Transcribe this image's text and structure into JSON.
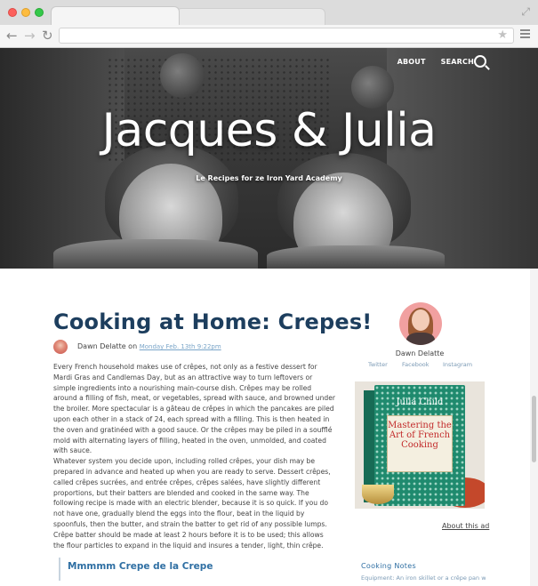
{
  "browser": {
    "icons": {
      "close": "red-dot",
      "minimize": "yellow-dot",
      "maximize": "green-dot",
      "back": "back-arrow-icon",
      "forward": "forward-arrow-icon",
      "reload": "reload-icon",
      "bookmark": "star-icon",
      "menu": "hamburger-menu-icon",
      "fullscreen": "expand-icon"
    }
  },
  "site": {
    "nav": {
      "about": "ABOUT",
      "search": "SEARCH"
    },
    "title": "Jacques & Julia",
    "tagline": "Le Recipes for ze Iron Yard Academy"
  },
  "post": {
    "title": "Cooking at Home: Crepes!",
    "author": "Dawn Delatte",
    "on": "on",
    "date": "Monday Feb. 13th 9:22pm",
    "paragraphs": [
      "Every French household makes use of crêpes, not only as a festive dessert for Mardi Gras and Candlemas Day, but as an attractive way to turn leftovers or simple ingredients into a nourishing main-course dish. Crêpes may be rolled around a filling of fish, meat, or vegetables, spread with sauce, and browned under the broiler. More spectacular is a gâteau de crêpes in which the pancakes are piled upon each other in a stack of 24, each spread with a filling. This is then heated in the oven and gratinéed with a good sauce. Or the crêpes may be piled in a soufflé mold with alternating layers of filling, heated in the oven, unmolded, and coated with sauce.",
      "Whatever system you decide upon, including rolled crêpes, your dish may be prepared in advance and heated up when you are ready to serve. Dessert crêpes, called crêpes sucrées, and entrée crêpes, crêpes salées, have slightly different proportions, but their batters are blended and cooked in the same way. The following recipe is made with an electric blender, because it is so quick. If you do not have one, gradually blend the eggs into the flour, beat in the liquid by spoonfuls, then the butter, and strain the batter to get rid of any possible lumps. Crêpe batter should be made at least 2 hours before it is to be used; this allows the flour particles to expand in the liquid and insures a tender, light, thin crêpe."
    ],
    "subheading": "Mmmmm Crepe de la Crepe"
  },
  "sidebar": {
    "author_name": "Dawn Delatte",
    "social": [
      "Twitter",
      "Facebook",
      "Instagram"
    ],
    "ad": {
      "book_author": "Julia Child",
      "book_title": "Mastering the Art of French Cooking"
    },
    "ad_link": "About this ad",
    "notes_heading": "Cooking Notes",
    "notes_text": "Equipment: An iron skillet or a crêpe pan wit"
  },
  "colors": {
    "title_blue": "#1d3e5e",
    "link_blue": "#2f6fa3",
    "muted_blue": "#7b9ab5"
  }
}
